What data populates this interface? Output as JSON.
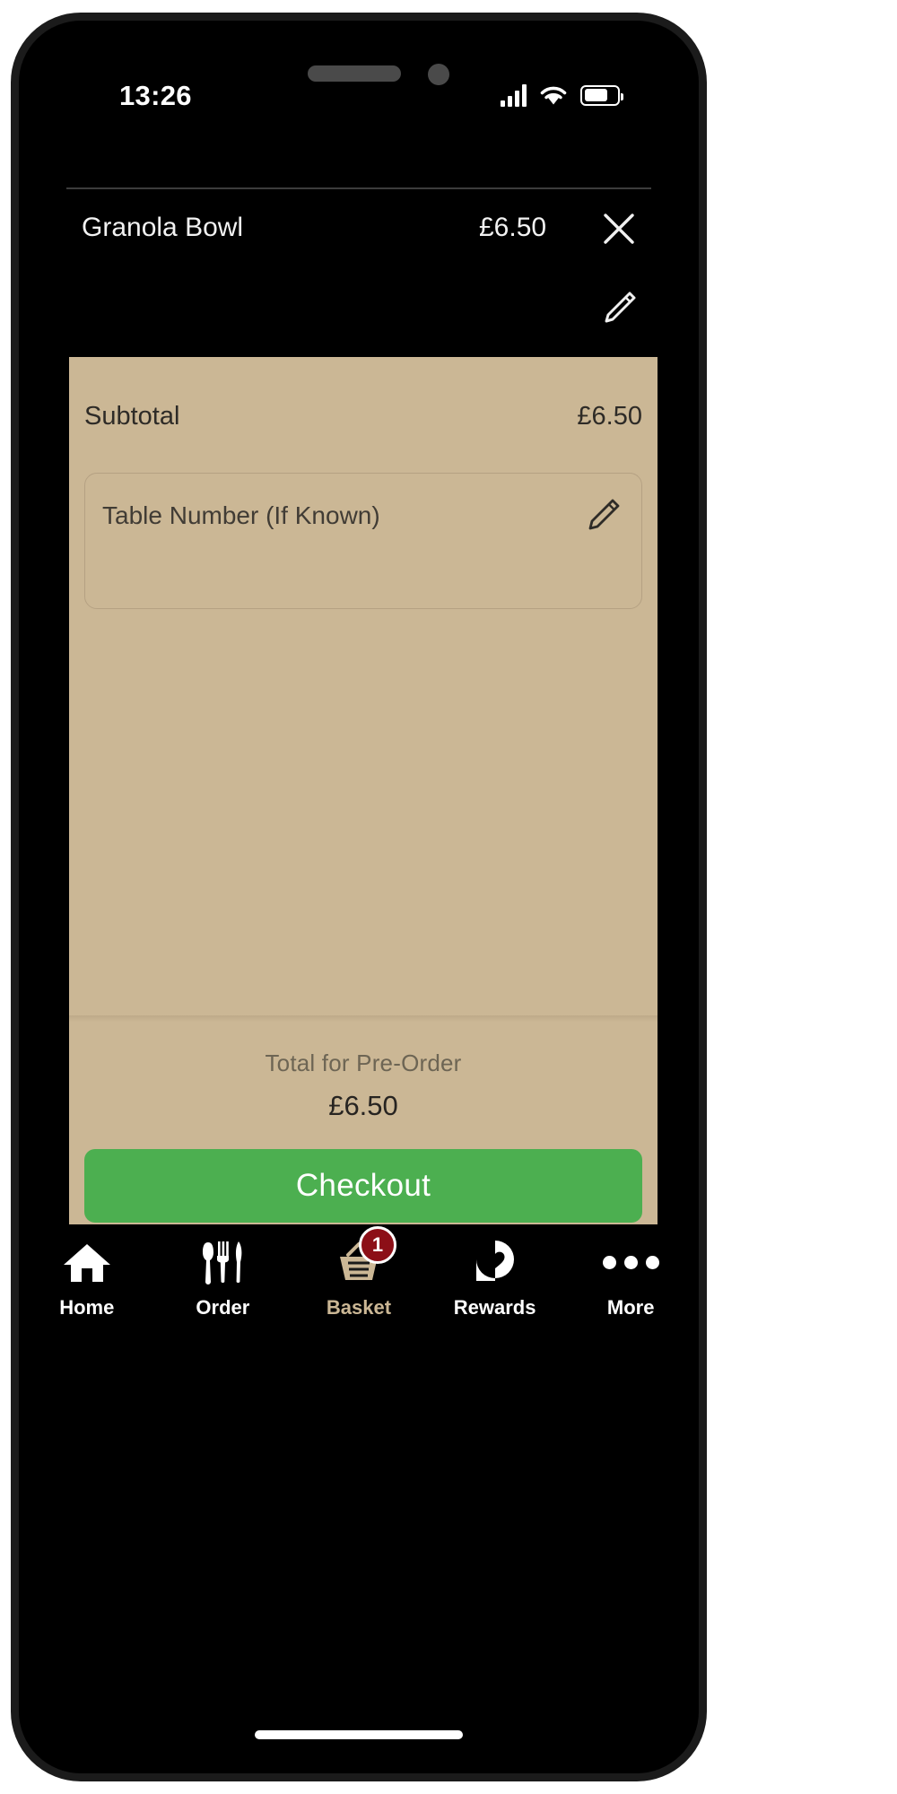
{
  "status_bar": {
    "time": "13:26",
    "signal_icon": "cellular-signal-icon",
    "wifi_icon": "wifi-icon",
    "battery_icon": "battery-icon",
    "battery_level_percent": 72
  },
  "cart": {
    "items": [
      {
        "name": "Granola Bowl",
        "price": "£6.50",
        "remove_icon": "close-icon",
        "edit_icon": "pencil-icon"
      }
    ]
  },
  "summary": {
    "subtotal_label": "Subtotal",
    "subtotal_value": "£6.50",
    "table_number_placeholder": "Table Number (If Known)",
    "table_number_value": "",
    "table_number_edit_icon": "pencil-icon",
    "total_label": "Total for Pre-Order",
    "total_value": "£6.50",
    "checkout_label": "Checkout",
    "panel_color": "#cbb795",
    "checkout_color": "#4caf50"
  },
  "tab_bar": {
    "items": [
      {
        "label": "Home",
        "icon": "home-icon",
        "active": false,
        "badge": ""
      },
      {
        "label": "Order",
        "icon": "cutlery-icon",
        "active": false,
        "badge": ""
      },
      {
        "label": "Basket",
        "icon": "basket-icon",
        "active": true,
        "badge": "1"
      },
      {
        "label": "Rewards",
        "icon": "heart-pin-icon",
        "active": false,
        "badge": ""
      },
      {
        "label": "More",
        "icon": "ellipsis-icon",
        "active": false,
        "badge": ""
      }
    ],
    "active_color": "#cbb795",
    "badge_color": "#8c0f17"
  }
}
